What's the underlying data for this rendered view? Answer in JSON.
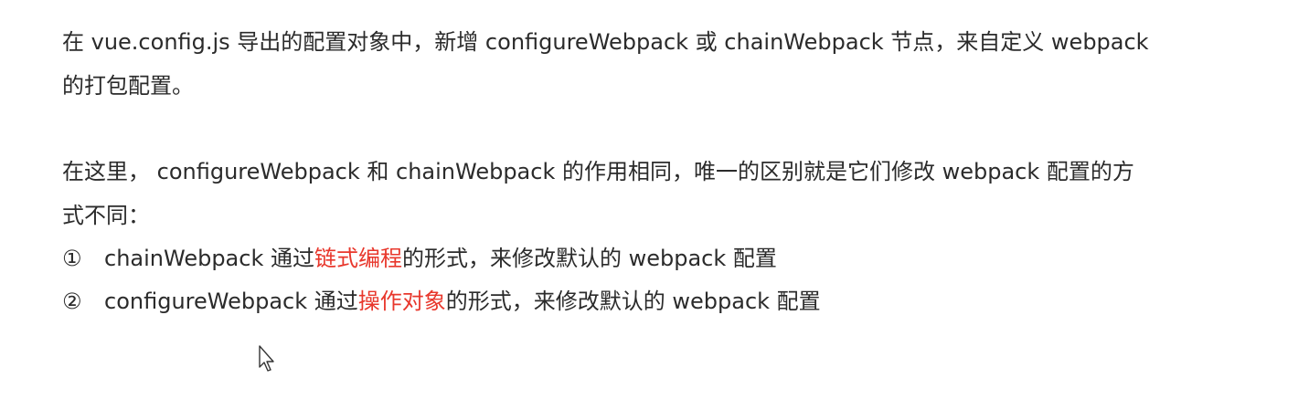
{
  "paragraph1": {
    "line1": "在 vue.config.js 导出的配置对象中，新增 configureWebpack 或 chainWebpack 节点，来自定义 webpack",
    "line2": "的打包配置。"
  },
  "paragraph2": {
    "line1": "在这里， configureWebpack 和 chainWebpack 的作用相同，唯一的区别就是它们修改 webpack 配置的方",
    "line2": "式不同："
  },
  "list": [
    {
      "marker": "①",
      "before": "chainWebpack 通过",
      "highlight": "链式编程",
      "after": "的形式，来修改默认的 webpack 配置"
    },
    {
      "marker": "②",
      "before": "configureWebpack 通过",
      "highlight": "操作对象",
      "after": "的形式，来修改默认的 webpack 配置"
    }
  ],
  "colors": {
    "text": "#2b2b2b",
    "highlight": "#e8372c",
    "background": "#ffffff"
  },
  "cursor": {
    "icon": "mouse-pointer-icon"
  }
}
